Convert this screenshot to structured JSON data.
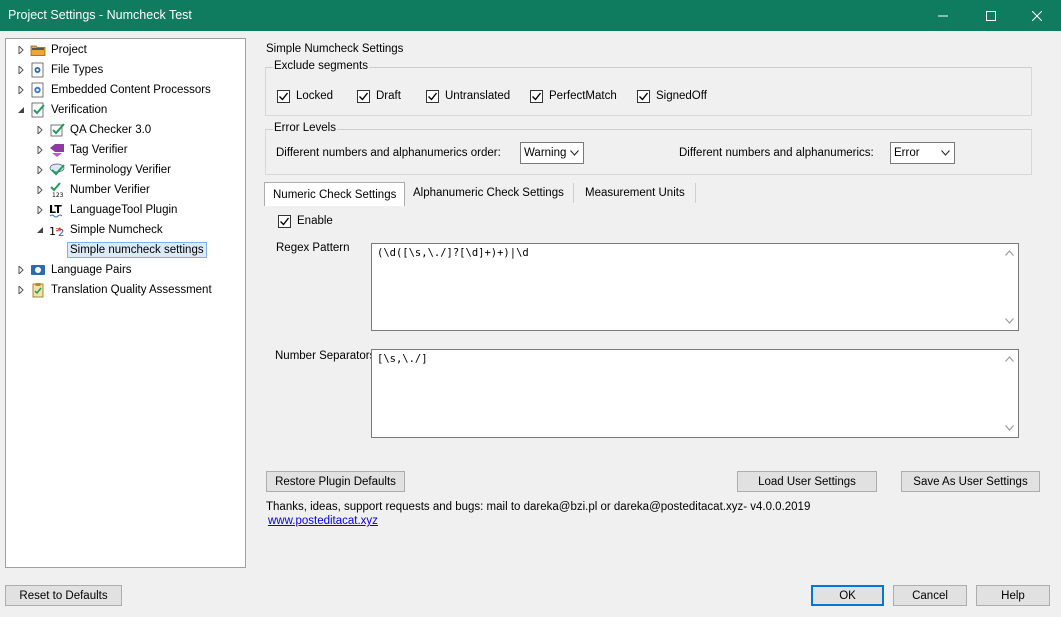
{
  "window": {
    "title": "Project Settings - Numcheck Test",
    "minimize_icon": "minimize-icon",
    "maximize_icon": "maximize-icon",
    "close_icon": "close-icon"
  },
  "tree": {
    "items": [
      {
        "label": "Project",
        "icon": "folder-icon",
        "level": 0,
        "expander": "collapsed"
      },
      {
        "label": "File Types",
        "icon": "file-gear-icon",
        "level": 0,
        "expander": "collapsed"
      },
      {
        "label": "Embedded Content Processors",
        "icon": "gear-doc-icon",
        "level": 0,
        "expander": "collapsed"
      },
      {
        "label": "Verification",
        "icon": "check-doc-icon",
        "level": 0,
        "expander": "expanded"
      },
      {
        "label": "QA Checker 3.0",
        "icon": "qa-check-icon",
        "level": 1,
        "expander": "collapsed"
      },
      {
        "label": "Tag Verifier",
        "icon": "tag-icon",
        "level": 1,
        "expander": "collapsed"
      },
      {
        "label": "Terminology Verifier",
        "icon": "terminology-icon",
        "level": 1,
        "expander": "collapsed"
      },
      {
        "label": "Number Verifier",
        "icon": "number-check-icon",
        "level": 1,
        "expander": "collapsed"
      },
      {
        "label": "LanguageTool Plugin",
        "icon": "lt-icon",
        "level": 1,
        "expander": "collapsed"
      },
      {
        "label": "Simple Numcheck",
        "icon": "numcheck-icon",
        "level": 1,
        "expander": "expanded"
      },
      {
        "label": "Simple numcheck settings",
        "icon": "",
        "level": 2,
        "expander": "none",
        "selected": true
      },
      {
        "label": "Language Pairs",
        "icon": "language-pairs-icon",
        "level": 0,
        "expander": "collapsed"
      },
      {
        "label": "Translation Quality Assessment",
        "icon": "clipboard-icon",
        "level": 0,
        "expander": "collapsed"
      }
    ]
  },
  "main": {
    "heading": "Simple Numcheck Settings",
    "exclude": {
      "title": "Exclude segments",
      "checkboxes": [
        {
          "label": "Locked",
          "checked": true
        },
        {
          "label": "Draft",
          "checked": true
        },
        {
          "label": "Untranslated",
          "checked": true
        },
        {
          "label": "PerfectMatch",
          "checked": true
        },
        {
          "label": "SignedOff",
          "checked": true
        }
      ]
    },
    "error_levels": {
      "title": "Error Levels",
      "order_label": "Different numbers and alphanumerics order:",
      "order_value": "Warning",
      "alnum_label": "Different numbers and alphanumerics:",
      "alnum_value": "Error"
    },
    "tabs": [
      {
        "label": "Numeric Check Settings",
        "active": true
      },
      {
        "label": "Alphanumeric Check Settings",
        "active": false
      },
      {
        "label": "Measurement Units",
        "active": false
      }
    ],
    "numeric": {
      "enable_label": "Enable",
      "enable_checked": true,
      "regex_label": "Regex Pattern",
      "regex_value": "(\\d([\\s,\\./]?[\\d]+)+)|\\d",
      "separators_label": "Number Separators",
      "separators_value": "[\\s,\\./]"
    },
    "buttons": {
      "restore": "Restore Plugin Defaults",
      "load": "Load User Settings",
      "save": "Save As User Settings"
    },
    "footer_text": "Thanks, ideas, support requests and bugs: mail to dareka@bzi.pl or dareka@posteditacat.xyz- v4.0.0.2019",
    "footer_link": "www.posteditacat.xyz"
  },
  "bottom": {
    "reset": "Reset to Defaults",
    "ok": "OK",
    "cancel": "Cancel",
    "help": "Help"
  },
  "colors": {
    "titlebar": "#0f7b5f",
    "accent": "#0078d7",
    "selection": "#dce9f7"
  }
}
